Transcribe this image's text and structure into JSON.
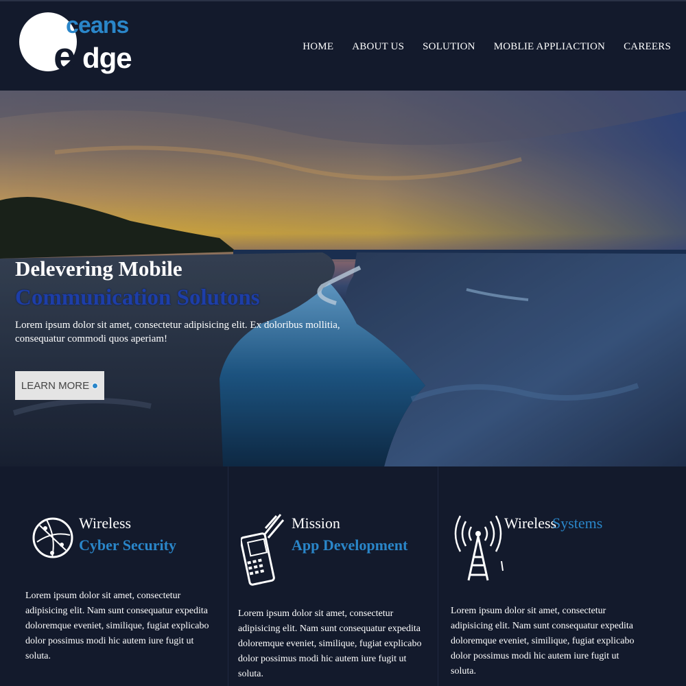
{
  "brand": {
    "logo_top": "ceans",
    "logo_e": "e",
    "logo_bottom": "dge",
    "accent_color": "#2a86c9"
  },
  "nav": {
    "items": [
      "HOME",
      "ABOUT US",
      "SOLUTION",
      "MOBLIE APPLIACTION",
      "CAREERS"
    ]
  },
  "hero": {
    "title_line1": "Delevering Mobile",
    "title_line2": "Communication Solutons",
    "description": "Lorem ipsum dolor sit amet, consectetur adipisicing elit. Ex doloribus mollitia, consequatur commodi quos aperiam!",
    "button_label": "LEARN MORE"
  },
  "features": [
    {
      "icon": "globe-icon",
      "title_line1": "Wireless",
      "title_line2": "Cyber Security",
      "description": "Lorem ipsum dolor sit amet, consectetur adipisicing elit. Nam sunt consequatur expedita doloremque eveniet, similique, fugiat explicabo dolor possimus modi hic autem iure fugit ut soluta."
    },
    {
      "icon": "mobile-phone-icon",
      "title_line1": "Mission",
      "title_line2": "App Development",
      "description": "Lorem ipsum dolor sit amet, consectetur adipisicing elit. Nam sunt consequatur expedita doloremque eveniet, similique, fugiat explicabo dolor possimus modi hic autem iure fugit ut soluta."
    },
    {
      "icon": "wireless-tower-icon",
      "title_line1": "Wireless",
      "title_line2": "Systems",
      "description": "Lorem ipsum dolor sit amet, consectetur adipisicing elit. Nam sunt consequatur expedita doloremque eveniet, similique, fugiat explicabo dolor possimus modi hic autem iure fugit ut soluta."
    }
  ]
}
